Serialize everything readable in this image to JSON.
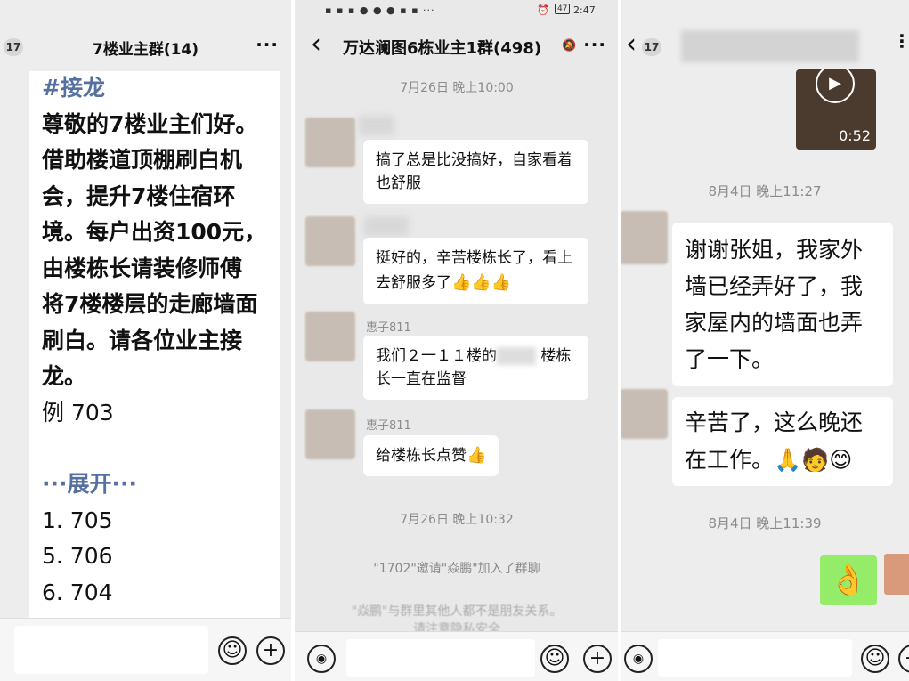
{
  "panel1": {
    "badge": "17",
    "title": "7楼业主群(14)",
    "more": "···",
    "hashtag": "#接龙",
    "lines": [
      "尊敬的7楼业主们好。",
      "借助楼道顶棚刷白机",
      "会，提升7楼住宿环",
      "境。每户出资100元，",
      "由楼栋长请装修师傅",
      "将7楼楼层的走廊墙面",
      "刷白。请各位业主接",
      "龙。",
      "例 703"
    ],
    "expand": "···展开···",
    "entries": [
      "1. 705",
      "5. 706",
      "6. 704"
    ]
  },
  "panel2": {
    "status_time": "2:47",
    "battery": "47",
    "title": "万达澜图6栋业主1群(498)",
    "more": "···",
    "time1": "7月26日 晚上10:00",
    "msg1": "搞了总是比没搞好，自家看着也舒服",
    "msg2": "挺好的，辛苦楼栋长了，看上去舒服多了",
    "msg2_emoji": "👍👍👍",
    "nick3": "惠子811",
    "msg3_a": "我们２一１１楼的",
    "msg3_b": "楼栋长一直在监督",
    "nick4": "惠子811",
    "msg4": "给楼栋长点赞",
    "msg4_emoji": "👍",
    "time2": "7月26日 晚上10:32",
    "sys1": "\"1702\"邀请\"焱鹏\"加入了群聊",
    "sys2": "\"焱鹏\"与群里其他人都不是朋友关系。",
    "sys3": "请注意隐私安全"
  },
  "panel3": {
    "badge": "17",
    "video_duration": "0:52",
    "time1": "8月4日 晚上11:27",
    "msg1": "谢谢张姐，我家外墙已经弄好了，我家屋内的墙面也弄了一下。",
    "msg2": "辛苦了，这么晚还在工作。",
    "msg2_emoji": "🙏🧑😊",
    "time2": "8月4日 晚上11:39",
    "sticker": "👌"
  },
  "icons": {
    "emoji": "☺",
    "plus": "+",
    "voice": "◉",
    "back": "‹"
  }
}
